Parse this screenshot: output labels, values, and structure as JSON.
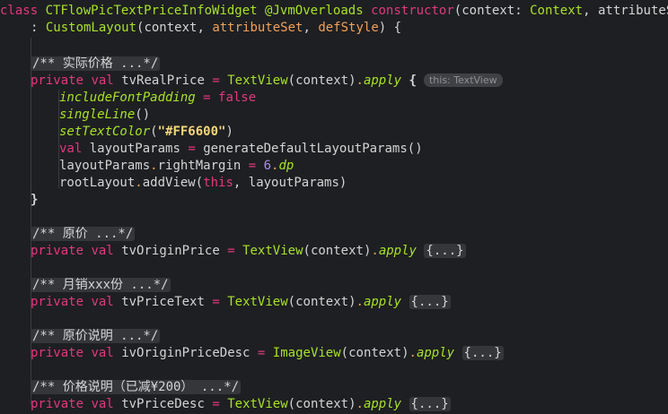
{
  "code": {
    "l1": {
      "kw_class": "class",
      "class_name": "CTFlowPicTextPriceInfoWidget",
      "annotation": "@JvmOverloads",
      "kw_constructor": "constructor",
      "paren_open": "(",
      "param_context": "context",
      "colon1": ": ",
      "type_context": "Context",
      "comma1": ", ",
      "param_attributeSet": "attributeSet",
      "colon2": ":"
    },
    "l2": {
      "prefix": ": ",
      "super_class": "CustomLayout",
      "args_open": "(context, ",
      "arg_attributeSet": "attributeSet",
      "comma": ", ",
      "arg_defStyle": "defStyle",
      "args_close": ") {"
    },
    "l4": {
      "comment": "/** 实际价格 ...*/"
    },
    "l5": {
      "kw_private": "private",
      "kw_val": "val",
      "name": "tvRealPrice",
      "eq": "=",
      "ctor": "TextView",
      "args": "(context)",
      "dot": ".",
      "apply": "apply",
      "brace": "{",
      "hint": "this: TextView"
    },
    "l6": {
      "prop": "includeFontPadding",
      "eq": " = ",
      "value": "false"
    },
    "l7": {
      "call": "singleLine",
      "parens": "()"
    },
    "l8": {
      "call": "setTextColor",
      "open": "(",
      "str": "\"#FF6600\"",
      "close": ")"
    },
    "l9": {
      "kw_val": "val",
      "name": "layoutParams",
      "eq": " = ",
      "call": "generateDefaultLayoutParams",
      "parens": "()"
    },
    "l10": {
      "obj": "layoutParams",
      "dot": ".",
      "prop": "rightMargin",
      "eq": " = ",
      "num": "6",
      "dot2": ".",
      "unit": "dp"
    },
    "l11": {
      "obj": "rootLayout",
      "dot": ".",
      "call": "addView",
      "open": "(",
      "kw_this": "this",
      "rest": ", layoutParams)"
    },
    "l12": {
      "brace": "}"
    },
    "l14": {
      "comment": "/** 原价 ...*/"
    },
    "l15": {
      "kw_private": "private",
      "kw_val": "val",
      "name": "tvOriginPrice",
      "eq": "=",
      "ctor": "TextView",
      "args": "(context)",
      "dot": ".",
      "apply": "apply",
      "folded": "{...}"
    },
    "l17": {
      "comment": "/** 月销xxx份 ...*/"
    },
    "l18": {
      "kw_private": "private",
      "kw_val": "val",
      "name": "tvPriceText",
      "eq": "=",
      "ctor": "TextView",
      "args": "(context)",
      "dot": ".",
      "apply": "apply",
      "folded": "{...}"
    },
    "l20": {
      "comment": "/** 原价说明 ...*/"
    },
    "l21": {
      "kw_private": "private",
      "kw_val": "val",
      "name": "ivOriginPriceDesc",
      "eq": "=",
      "ctor": "ImageView",
      "args": "(context)",
      "dot": ".",
      "apply": "apply",
      "folded": "{...}"
    },
    "l23": {
      "comment": "/** 价格说明（已减¥200） ...*/"
    },
    "l24": {
      "kw_private": "private",
      "kw_val": "val",
      "name": "tvPriceDesc",
      "eq": "=",
      "ctor": "TextView",
      "args": "(context)",
      "dot": ".",
      "apply": "apply",
      "folded": "{...}"
    }
  },
  "colors": {
    "background": "#1e1f22",
    "keyword": "#e0397f",
    "class_name": "#a8e22a",
    "parameter": "#f0a15a",
    "string": "#f5d67a",
    "number": "#a98dfb",
    "fold_background": "#34363a"
  }
}
